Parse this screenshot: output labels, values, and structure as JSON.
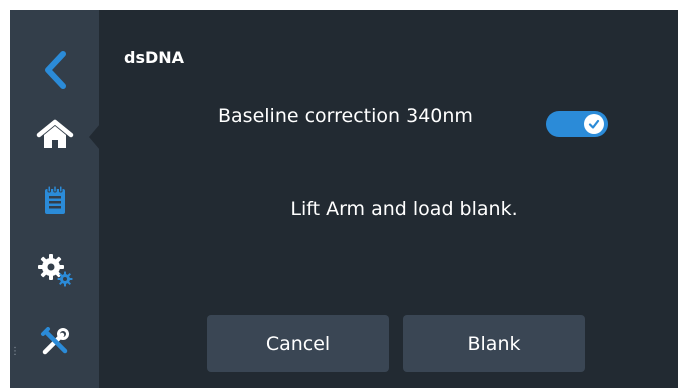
{
  "header": {
    "title": "dsDNA"
  },
  "settings": {
    "baseline_label": "Baseline correction 340nm",
    "baseline_enabled": true
  },
  "instruction": "Lift Arm and load blank.",
  "buttons": {
    "cancel": "Cancel",
    "blank": "Blank"
  },
  "sidebar": {
    "items": [
      {
        "icon": "back-chevron-icon",
        "active": false
      },
      {
        "icon": "home-icon",
        "active": true
      },
      {
        "icon": "clipboard-icon",
        "active": false
      },
      {
        "icon": "gears-icon",
        "active": false
      },
      {
        "icon": "tools-icon",
        "active": false
      }
    ]
  },
  "colors": {
    "accent": "#2b8bd8",
    "background": "#222a32",
    "sidebar": "#333e4a",
    "button": "#3a4654"
  }
}
